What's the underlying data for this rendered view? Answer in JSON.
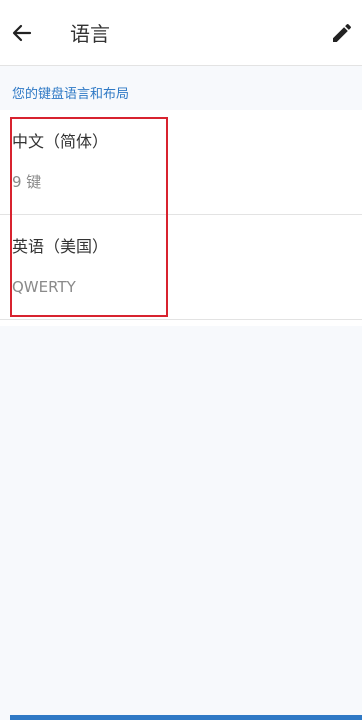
{
  "header": {
    "title": "语言",
    "back_icon": "arrow-left-icon",
    "edit_icon": "pencil-icon"
  },
  "section": {
    "label": "您的键盘语言和布局"
  },
  "languages": [
    {
      "name": "中文（简体）",
      "layout": "9 键"
    },
    {
      "name": "英语（美国）",
      "layout": "QWERTY"
    }
  ],
  "colors": {
    "accent": "#2f79c5",
    "highlight": "#d8232f",
    "text": "#333333",
    "secondary_text": "#8a8a8a"
  }
}
